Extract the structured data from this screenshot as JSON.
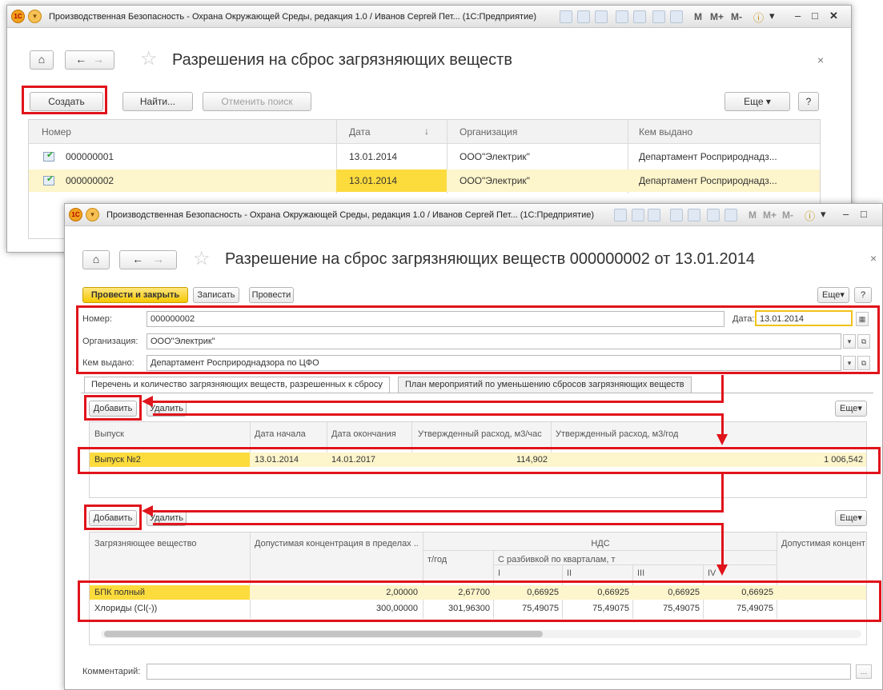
{
  "colors": {
    "accent_red": "#e0141b",
    "selection": "#fdf5cb",
    "date_highlight": "#fcdb3d",
    "primary_button": "#f5c800"
  },
  "back_window": {
    "titlebar": {
      "title": "Производственная Безопасность - Охрана Окружающей Среды, редакция 1.0 / Иванов Сергей Пет... (1С:Предприятие)",
      "controls": [
        "M",
        "M+",
        "M-"
      ]
    },
    "page_title": "Разрешения на сброс загрязняющих веществ",
    "buttons": {
      "create": "Создать",
      "find": "Найти...",
      "cancel_search": "Отменить поиск",
      "more": "Еще",
      "help": "?"
    },
    "table": {
      "headers": {
        "number": "Номер",
        "date": "Дата",
        "sort": "↓",
        "org": "Организация",
        "issued": "Кем выдано"
      },
      "rows": [
        {
          "number": "000000001",
          "date": "13.01.2014",
          "org": "ООО\"Электрик\"",
          "issued": "Департамент Росприроднадз..."
        },
        {
          "number": "000000002",
          "date": "13.01.2014",
          "org": "ООО\"Электрик\"",
          "issued": "Департамент Росприроднадз..."
        }
      ]
    }
  },
  "front_window": {
    "titlebar": {
      "title": "Производственная Безопасность - Охрана Окружающей Среды, редакция 1.0 / Иванов Сергей Пет... (1С:Предприятие)",
      "controls": [
        "M",
        "M+",
        "M-"
      ]
    },
    "page_title": "Разрешение на сброс загрязняющих веществ 000000002 от 13.01.2014",
    "buttons": {
      "post_close": "Провести и закрыть",
      "save": "Записать",
      "post": "Провести",
      "more": "Еще",
      "help": "?"
    },
    "form": {
      "number_label": "Номер:",
      "number_value": "000000002",
      "date_label": "Дата:",
      "date_value": "13.01.2014",
      "org_label": "Организация:",
      "org_value": "ООО\"Электрик\"",
      "issued_label": "Кем выдано:",
      "issued_value": "Департамент Росприроднадзора по ЦФО"
    },
    "tabs": [
      "Перечень и количество загрязняющих веществ, разрешенных к сбросу",
      "План мероприятий по уменьшению сбросов загрязняющих веществ"
    ],
    "table1": {
      "add": "Добавить",
      "delete": "Удалить",
      "more": "Еще",
      "headers": [
        "Выпуск",
        "Дата начала",
        "Дата окончания",
        "Утвержденный расход, м3/час",
        "Утвержденный расход, м3/год"
      ],
      "row": {
        "release": "Выпуск №2",
        "start": "13.01.2014",
        "end": "14.01.2017",
        "hour": "114,902",
        "year": "1 006,542"
      }
    },
    "table2": {
      "add": "Добавить",
      "delete": "Удалить",
      "more": "Еще",
      "headers": {
        "substance": "Загрязняющее вещество",
        "allowed_conc": "Допустимая концентрация в пределах ...",
        "nds": "НДС",
        "t_year": "т/год",
        "by_quarters": "С разбивкой по кварталам, т",
        "q1": "I",
        "q2": "II",
        "q3": "III",
        "q4": "IV",
        "allowed_conc2": "Допустимая концент"
      },
      "rows": [
        {
          "substance": "БПК полный",
          "conc": "2,00000",
          "t_year": "2,67700",
          "q1": "0,66925",
          "q2": "0,66925",
          "q3": "0,66925",
          "q4": "0,66925"
        },
        {
          "substance": "Хлориды (Cl(-))",
          "conc": "300,00000",
          "t_year": "301,96300",
          "q1": "75,49075",
          "q2": "75,49075",
          "q3": "75,49075",
          "q4": "75,49075"
        }
      ]
    },
    "comment_label": "Комментарий:"
  }
}
